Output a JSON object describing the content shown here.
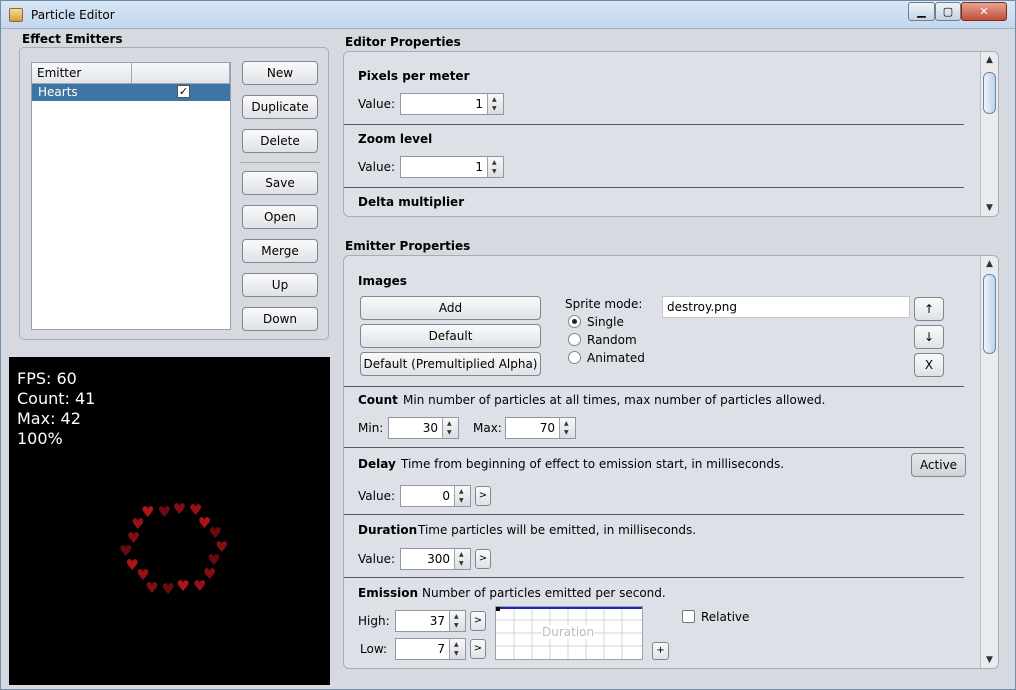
{
  "window": {
    "title": "Particle Editor",
    "min_icon": "▁",
    "max_icon": "▢",
    "close_icon": "✕"
  },
  "emitters_panel": {
    "title": "Effect Emitters",
    "column_header": "Emitter",
    "rows": [
      {
        "name": "Hearts",
        "checked": "✓"
      }
    ],
    "buttons": {
      "new": "New",
      "duplicate": "Duplicate",
      "delete": "Delete",
      "save": "Save",
      "open": "Open",
      "merge": "Merge",
      "up": "Up",
      "down": "Down"
    }
  },
  "preview": {
    "fps": "FPS: 60",
    "count": "Count: 41",
    "max": "Max: 42",
    "zoom": "100%",
    "particle_color": "#c0151b"
  },
  "editor_props": {
    "title": "Editor Properties",
    "pixels_per_meter": {
      "title": "Pixels per meter",
      "label": "Value:",
      "value": "1"
    },
    "zoom_level": {
      "title": "Zoom level",
      "label": "Value:",
      "value": "1"
    },
    "delta_multiplier": {
      "title": "Delta multiplier"
    }
  },
  "emitter_props": {
    "title": "Emitter Properties",
    "images": {
      "title": "Images",
      "add": "Add",
      "default": "Default",
      "default_premult": "Default (Premultiplied Alpha)",
      "sprite_mode_label": "Sprite mode:",
      "modes": [
        "Single",
        "Random",
        "Animated"
      ],
      "selected_mode": "Single",
      "file": "destroy.png",
      "up": "↑",
      "down": "↓",
      "remove": "X"
    },
    "count": {
      "title": "Count",
      "desc": "Min number of particles at all times, max number of particles allowed.",
      "min_label": "Min:",
      "min": "30",
      "max_label": "Max:",
      "max": "70"
    },
    "delay": {
      "title": "Delay",
      "desc": "Time from beginning of effect to emission start, in milliseconds.",
      "label": "Value:",
      "value": "0",
      "active": "Active",
      "expand": ">"
    },
    "duration": {
      "title": "Duration",
      "desc": "Time particles will be emitted, in milliseconds.",
      "label": "Value:",
      "value": "300",
      "expand": ">"
    },
    "emission": {
      "title": "Emission",
      "desc": "Number of particles emitted per second.",
      "high_label": "High:",
      "high": "37",
      "low_label": "Low:",
      "low": "7",
      "chart_label": "Duration",
      "relative": "Relative",
      "plus": "+",
      "expand": ">"
    }
  }
}
